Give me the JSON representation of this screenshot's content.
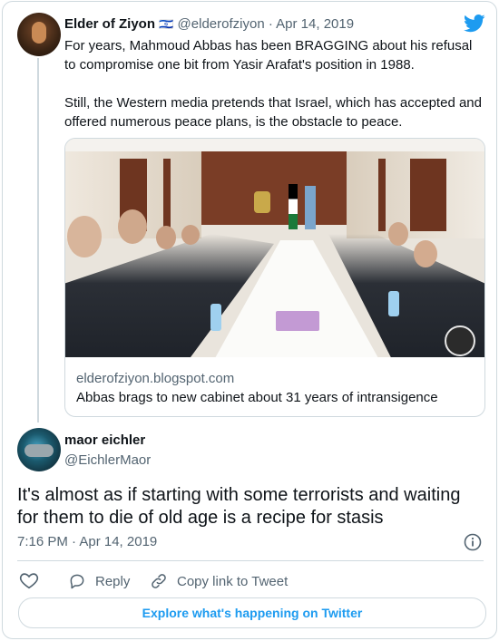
{
  "quoted": {
    "name": "Elder of Ziyon",
    "flag": "🇮🇱",
    "handle": "@elderofziyon",
    "date": "· Apr 14, 2019",
    "para1": "For years, Mahmoud Abbas has been BRAGGING about his refusal to compromise one bit from Yasir Arafat's position in 1988.",
    "para2": "Still, the Western media pretends that Israel, which has accepted and offered numerous peace plans, is the obstacle to peace.",
    "link_domain": "elderofziyon.blogspot.com",
    "link_title": "Abbas brags to new cabinet about 31 years of intransigence"
  },
  "reply": {
    "name": "maor eichler",
    "handle": "@EichlerMaor",
    "text": "It's almost as if starting with some terrorists and waiting for them to die of old age is a recipe for stasis",
    "timestamp": "7:16 PM · Apr 14, 2019"
  },
  "actions": {
    "reply_label": "Reply",
    "copy_label": "Copy link to Tweet"
  },
  "explore_label": "Explore what's happening on Twitter",
  "colors": {
    "accent": "#1d9bf0",
    "muted": "#536471",
    "border": "#cfd9de",
    "like_icon": "#536471"
  },
  "icons": [
    "twitter-bird-icon",
    "info-icon",
    "heart-icon",
    "reply-icon",
    "link-icon"
  ]
}
